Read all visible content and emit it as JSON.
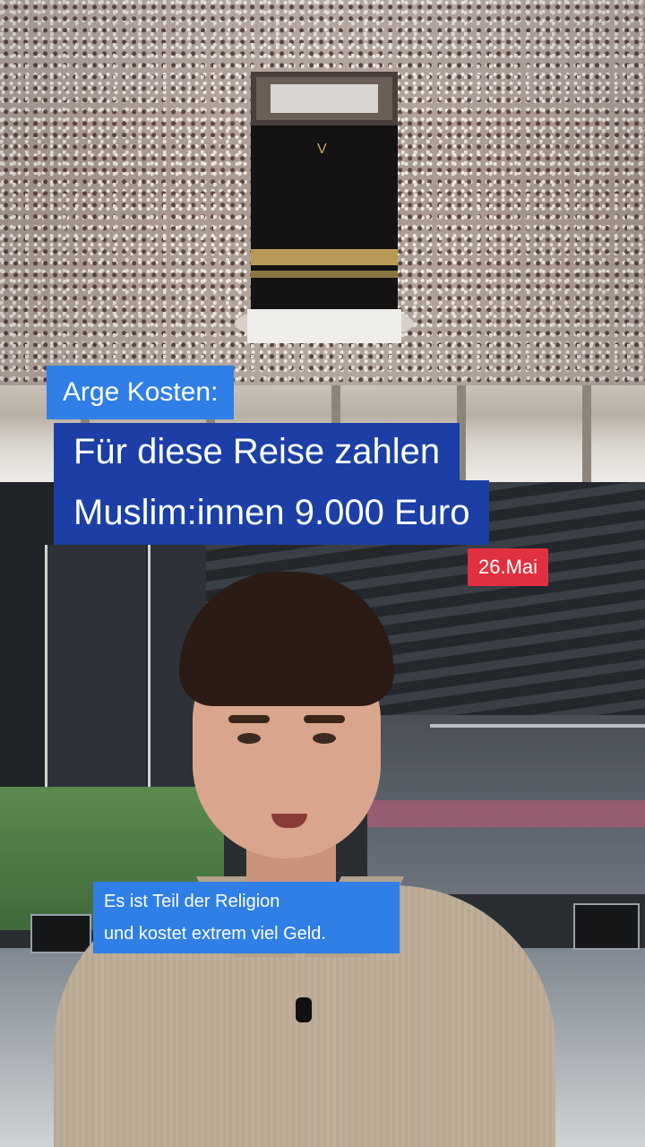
{
  "overlay": {
    "kicker": "Arge Kosten:",
    "headline_line1": "Für diese Reise zahlen",
    "headline_line2": "Muslim:innen 9.000 Euro",
    "date": "26.Mai"
  },
  "subtitle": {
    "line1": "Es ist Teil der Religion",
    "line2": "und kostet extrem viel Geld."
  },
  "colors": {
    "kicker_bg": "#2f7fe6",
    "headline_bg": "#1b3fa6",
    "date_bg": "#e1303f",
    "subtitle_bg": "#2f7fe6"
  }
}
